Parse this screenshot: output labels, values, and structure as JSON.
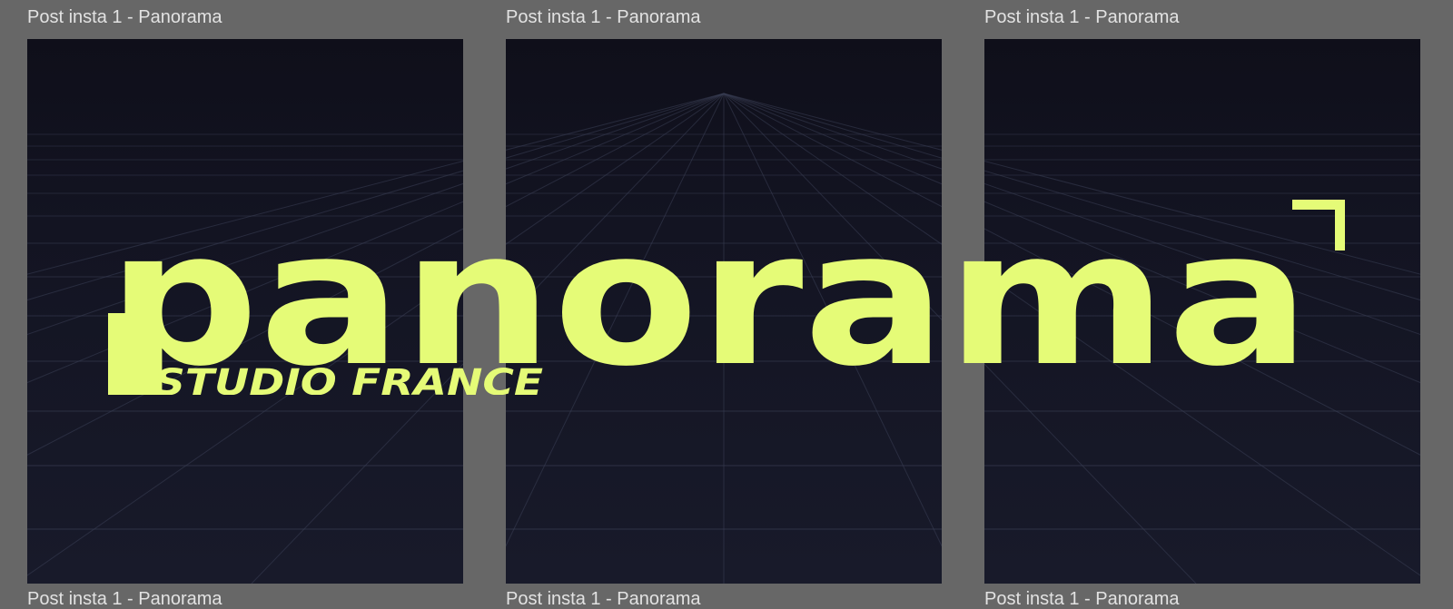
{
  "canvas": {
    "frames": [
      {
        "label": "Post insta 1 - Panorama"
      },
      {
        "label": "Post insta 1 - Panorama"
      },
      {
        "label": "Post insta 1 - Panorama"
      }
    ],
    "bottom_labels": [
      {
        "label": "Post insta 1 - Panorama"
      },
      {
        "label": "Post insta 1 - Panorama"
      },
      {
        "label": "Post insta 1 - Panorama"
      }
    ]
  },
  "artwork": {
    "wordmark": "panorama",
    "tagline": "STUDIO FRANCE",
    "accent_color": "#e5fb77",
    "background_color": "#141523",
    "grid_color": "#3a3f55",
    "corner_mark_icon": "corner-bracket-icon"
  }
}
